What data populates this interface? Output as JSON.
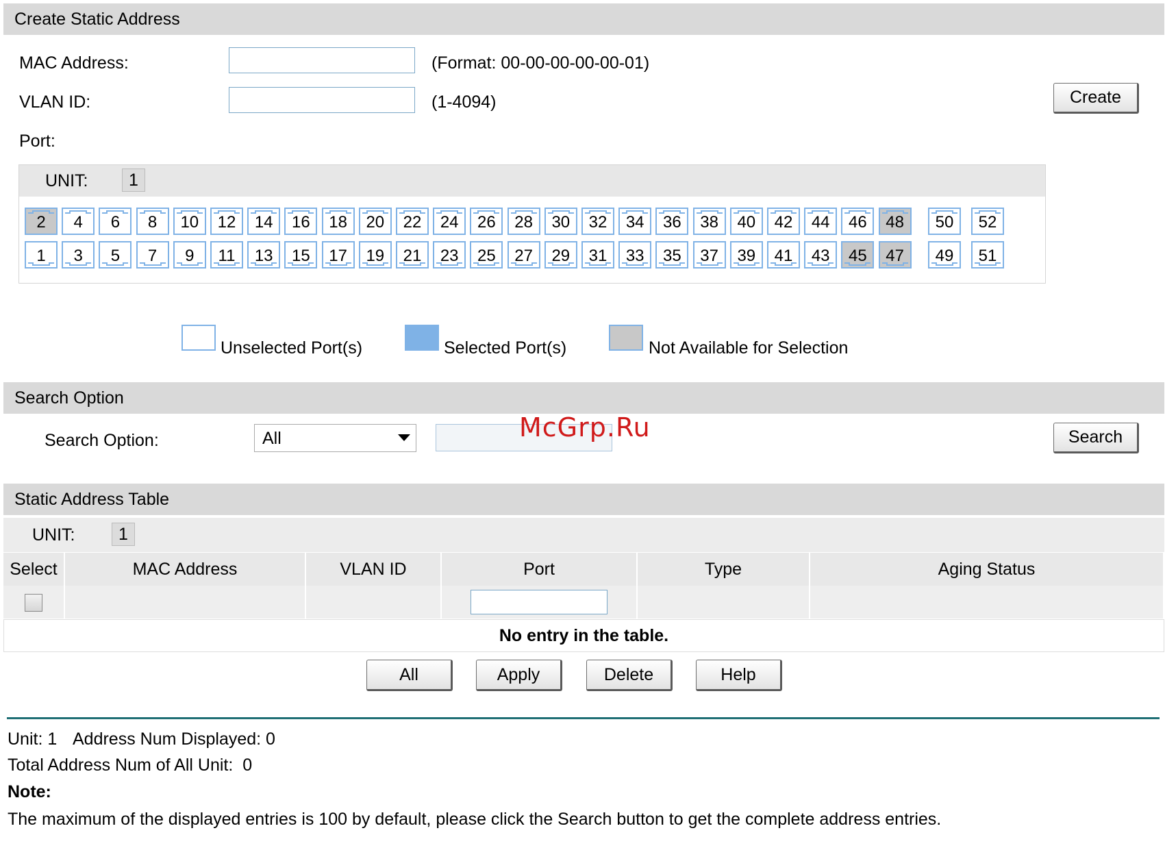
{
  "create_section": {
    "title": "Create Static Address",
    "mac_label": "MAC Address:",
    "mac_value": "",
    "mac_hint": "(Format: 00-00-00-00-00-01)",
    "vlan_label": "VLAN ID:",
    "vlan_value": "",
    "vlan_hint": "(1-4094)",
    "create_button": "Create",
    "port_label": "Port:",
    "unit_label": "UNIT:",
    "unit_value": "1",
    "ports_top": [
      {
        "n": "2",
        "state": "na"
      },
      {
        "n": "4",
        "state": "free"
      },
      {
        "n": "6",
        "state": "free"
      },
      {
        "n": "8",
        "state": "free"
      },
      {
        "n": "10",
        "state": "free"
      },
      {
        "n": "12",
        "state": "free"
      },
      {
        "n": "14",
        "state": "free"
      },
      {
        "n": "16",
        "state": "free"
      },
      {
        "n": "18",
        "state": "free"
      },
      {
        "n": "20",
        "state": "free"
      },
      {
        "n": "22",
        "state": "free"
      },
      {
        "n": "24",
        "state": "free"
      },
      {
        "n": "26",
        "state": "free"
      },
      {
        "n": "28",
        "state": "free"
      },
      {
        "n": "30",
        "state": "free"
      },
      {
        "n": "32",
        "state": "free"
      },
      {
        "n": "34",
        "state": "free"
      },
      {
        "n": "36",
        "state": "free"
      },
      {
        "n": "38",
        "state": "free"
      },
      {
        "n": "40",
        "state": "free"
      },
      {
        "n": "42",
        "state": "free"
      },
      {
        "n": "44",
        "state": "free"
      },
      {
        "n": "46",
        "state": "free"
      },
      {
        "n": "48",
        "state": "na"
      },
      {
        "n": "50",
        "state": "free"
      },
      {
        "n": "52",
        "state": "free"
      }
    ],
    "ports_bottom": [
      {
        "n": "1",
        "state": "free"
      },
      {
        "n": "3",
        "state": "free"
      },
      {
        "n": "5",
        "state": "free"
      },
      {
        "n": "7",
        "state": "free"
      },
      {
        "n": "9",
        "state": "free"
      },
      {
        "n": "11",
        "state": "free"
      },
      {
        "n": "13",
        "state": "free"
      },
      {
        "n": "15",
        "state": "free"
      },
      {
        "n": "17",
        "state": "free"
      },
      {
        "n": "19",
        "state": "free"
      },
      {
        "n": "21",
        "state": "free"
      },
      {
        "n": "23",
        "state": "free"
      },
      {
        "n": "25",
        "state": "free"
      },
      {
        "n": "27",
        "state": "free"
      },
      {
        "n": "29",
        "state": "free"
      },
      {
        "n": "31",
        "state": "free"
      },
      {
        "n": "33",
        "state": "free"
      },
      {
        "n": "35",
        "state": "free"
      },
      {
        "n": "37",
        "state": "free"
      },
      {
        "n": "39",
        "state": "free"
      },
      {
        "n": "41",
        "state": "free"
      },
      {
        "n": "43",
        "state": "free"
      },
      {
        "n": "45",
        "state": "na"
      },
      {
        "n": "47",
        "state": "na"
      },
      {
        "n": "49",
        "state": "free"
      },
      {
        "n": "51",
        "state": "free"
      }
    ],
    "legend": {
      "unselected": "Unselected Port(s)",
      "selected": "Selected Port(s)",
      "not_available": "Not Available for Selection"
    }
  },
  "search_section": {
    "title": "Search Option",
    "label": "Search Option:",
    "selected_option": "All",
    "search_value": "",
    "search_button": "Search"
  },
  "table_section": {
    "title": "Static Address Table",
    "unit_label": "UNIT:",
    "unit_value": "1",
    "columns": [
      "Select",
      "MAC Address",
      "VLAN ID",
      "Port",
      "Type",
      "Aging Status"
    ],
    "empty_message": "No entry in the table.",
    "buttons": {
      "all": "All",
      "apply": "Apply",
      "delete": "Delete",
      "help": "Help"
    }
  },
  "footer": {
    "unit_text": "Unit: 1",
    "displayed_text": "Address Num Displayed: 0",
    "total_text": "Total Address Num of All Unit:  0",
    "note_label": "Note:",
    "note_text": "The maximum of the displayed entries is 100 by default, please click the Search button to get the complete address entries."
  },
  "watermark": "McGrp.Ru",
  "colors": {
    "header_bg": "#d9d9d9",
    "port_border": "#7fb2e6",
    "port_na": "#c8c8c8",
    "port_selected": "#7fb2e6",
    "divider": "#1f6f75",
    "watermark": "#d01a1a"
  }
}
